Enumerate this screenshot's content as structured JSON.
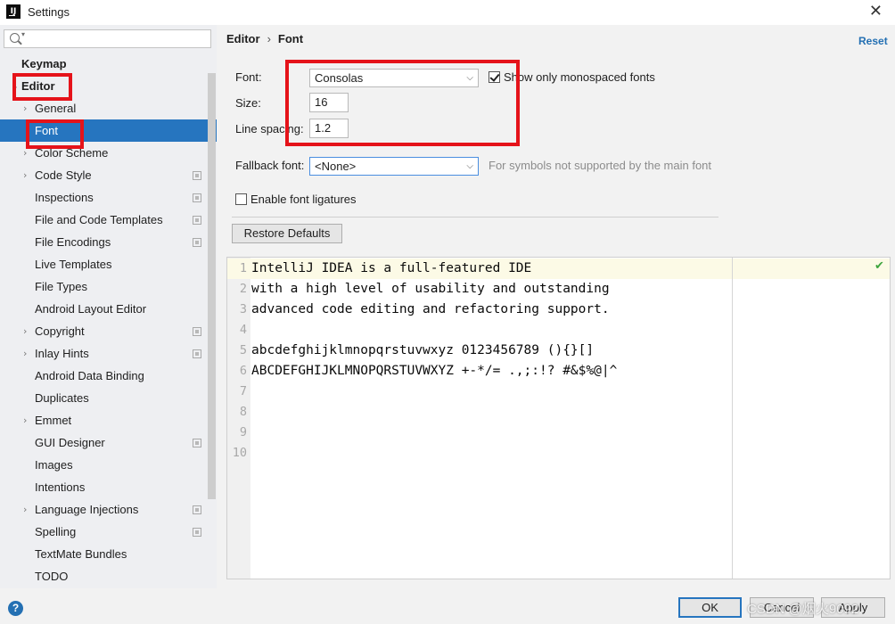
{
  "window": {
    "title": "Settings",
    "app_icon_text": "IJ"
  },
  "search": {
    "placeholder": ""
  },
  "sidebar": {
    "items": [
      {
        "label": "Keymap",
        "bold": true
      },
      {
        "label": "Editor",
        "bold": true,
        "expanded": true
      },
      {
        "label": "General"
      },
      {
        "label": "Font",
        "selected": true
      },
      {
        "label": "Color Scheme"
      },
      {
        "label": "Code Style"
      },
      {
        "label": "Inspections"
      },
      {
        "label": "File and Code Templates"
      },
      {
        "label": "File Encodings"
      },
      {
        "label": "Live Templates"
      },
      {
        "label": "File Types"
      },
      {
        "label": "Android Layout Editor"
      },
      {
        "label": "Copyright"
      },
      {
        "label": "Inlay Hints"
      },
      {
        "label": "Android Data Binding"
      },
      {
        "label": "Duplicates"
      },
      {
        "label": "Emmet"
      },
      {
        "label": "GUI Designer"
      },
      {
        "label": "Images"
      },
      {
        "label": "Intentions"
      },
      {
        "label": "Language Injections"
      },
      {
        "label": "Spelling"
      },
      {
        "label": "TextMate Bundles"
      },
      {
        "label": "TODO"
      }
    ]
  },
  "header": {
    "breadcrumb_parent": "Editor",
    "breadcrumb_sep": "›",
    "breadcrumb_current": "Font",
    "reset_label": "Reset"
  },
  "font_settings": {
    "font_label": "Font:",
    "font_value": "Consolas",
    "monospaced_label": "Show only monospaced fonts",
    "monospaced_checked": true,
    "size_label": "Size:",
    "size_value": "16",
    "line_spacing_label": "Line spacing:",
    "line_spacing_value": "1.2",
    "fallback_label": "Fallback font:",
    "fallback_value": "<None>",
    "fallback_hint": "For symbols not supported by the main font",
    "ligatures_label": "Enable font ligatures",
    "ligatures_checked": false,
    "restore_label": "Restore Defaults"
  },
  "preview": {
    "lines": [
      {
        "n": "1",
        "text": "IntelliJ IDEA is a full-featured IDE"
      },
      {
        "n": "2",
        "text": "with a high level of usability and outstanding"
      },
      {
        "n": "3",
        "text": "advanced code editing and refactoring support."
      },
      {
        "n": "4",
        "text": ""
      },
      {
        "n": "5",
        "text": "abcdefghijklmnopqrstuvwxyz 0123456789 (){}[]"
      },
      {
        "n": "6",
        "text": "ABCDEFGHIJKLMNOPQRSTUVWXYZ +-*/= .,;:!? #&$%@|^"
      },
      {
        "n": "7",
        "text": ""
      },
      {
        "n": "8",
        "text": ""
      },
      {
        "n": "9",
        "text": ""
      },
      {
        "n": "10",
        "text": ""
      }
    ]
  },
  "footer": {
    "ok_label": "OK",
    "cancel_label": "Cancel",
    "apply_label": "Apply",
    "help_label": "?",
    "watermark": "CSDN @烟火9092"
  },
  "colors": {
    "selection": "#2675bf",
    "annotation": "#e5131a",
    "link": "#2470b3"
  }
}
